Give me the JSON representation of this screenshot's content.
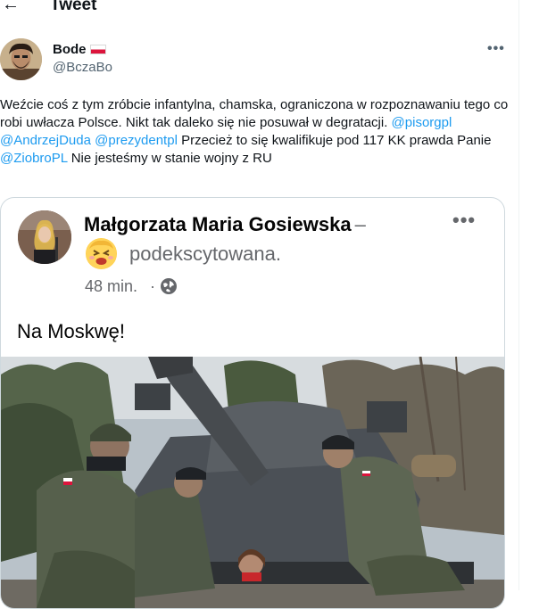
{
  "header": {
    "back_icon": "arrow-left-icon",
    "title": "Tweet"
  },
  "author": {
    "name": "Bode",
    "handle": "@BczaBo",
    "flag_icon": "poland-flag-icon"
  },
  "more_icon": "more-horizontal-icon",
  "tweet": {
    "text_1": "Weźcie coś z tym zróbcie infantylna, chamska, ograniczona w rozpoznawaniu tego co robi uwłacza  Polsce. Nikt tak daleko się nie posuwał w degratacji. ",
    "mention_1": "@pisorgpl",
    "mention_2": "@AndrzejDuda",
    "mention_3": "@prezydentpl",
    "text_2": " Przecież to się kwalifikuje pod 117 KK prawda Panie ",
    "mention_4": "@ZiobroPL",
    "text_3": " Nie jesteśmy w stanie wojny z RU"
  },
  "embedded_post": {
    "author_name": "Małgorzata Maria Gosiewska",
    "dash": "–",
    "feeling_emoji_icon": "excited-face-emoji-icon",
    "feeling": "podekscytowana.",
    "time": "48 min.",
    "separator": "·",
    "audience_icon": "globe-icon",
    "text": "Na Moskwę!"
  },
  "colors": {
    "accent": "#1d9bf0",
    "secondary_text": "#536471",
    "border": "#cfd9de"
  }
}
